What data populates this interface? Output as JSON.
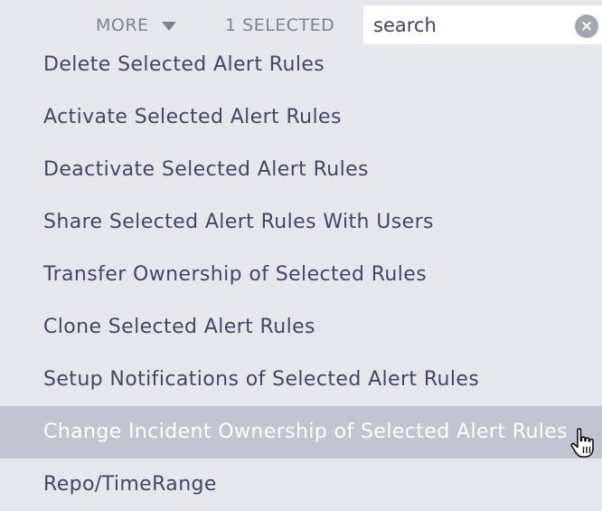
{
  "toolbar": {
    "more_label": "MORE",
    "selected_count": "1 SELECTED",
    "search_placeholder": "search",
    "search_value": "search"
  },
  "menu": {
    "items": [
      {
        "label": "Delete Selected Alert Rules",
        "highlighted": false
      },
      {
        "label": "Activate Selected Alert Rules",
        "highlighted": false
      },
      {
        "label": "Deactivate Selected Alert Rules",
        "highlighted": false
      },
      {
        "label": "Share Selected Alert Rules With Users",
        "highlighted": false
      },
      {
        "label": "Transfer Ownership of Selected Rules",
        "highlighted": false
      },
      {
        "label": "Clone Selected Alert Rules",
        "highlighted": false
      },
      {
        "label": "Setup Notifications of Selected Alert Rules",
        "highlighted": false
      },
      {
        "label": "Change Incident Ownership of Selected Alert Rules",
        "highlighted": true
      },
      {
        "label": "Repo/TimeRange",
        "highlighted": false
      }
    ]
  },
  "icons": {
    "more_caret": "caret-down-icon",
    "search_clear": "clear-circle-icon",
    "cursor": "hand-pointer-icon"
  },
  "colors": {
    "background": "#e6e7ec",
    "menu_text": "#434762",
    "toolbar_text": "#7e8392",
    "highlight_bg": "#c2c5d0",
    "highlight_text": "#ffffff"
  }
}
